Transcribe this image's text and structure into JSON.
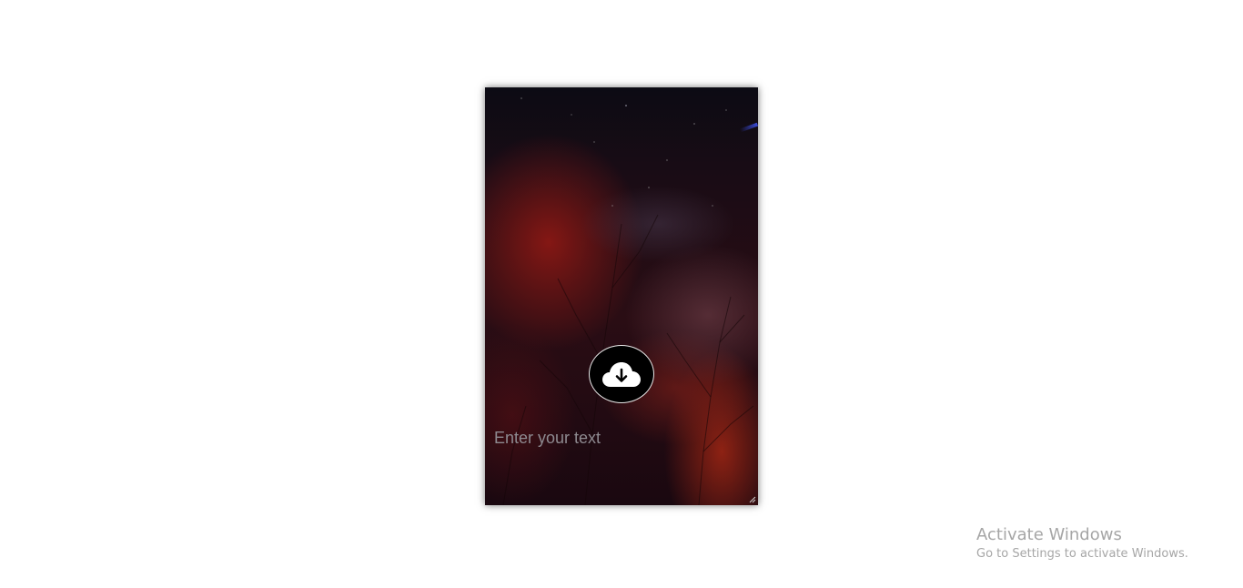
{
  "card": {
    "input_placeholder": "Enter your text",
    "input_value": "",
    "button_icon": "cloud-download-icon"
  },
  "watermark": {
    "title": "Activate Windows",
    "subtitle": "Go to Settings to activate Windows."
  },
  "colors": {
    "page_background": "#ffffff",
    "button_background": "#000000",
    "button_border": "#e8e8e8",
    "placeholder": "#8e8a90",
    "watermark_text": "#a6a6a6"
  }
}
